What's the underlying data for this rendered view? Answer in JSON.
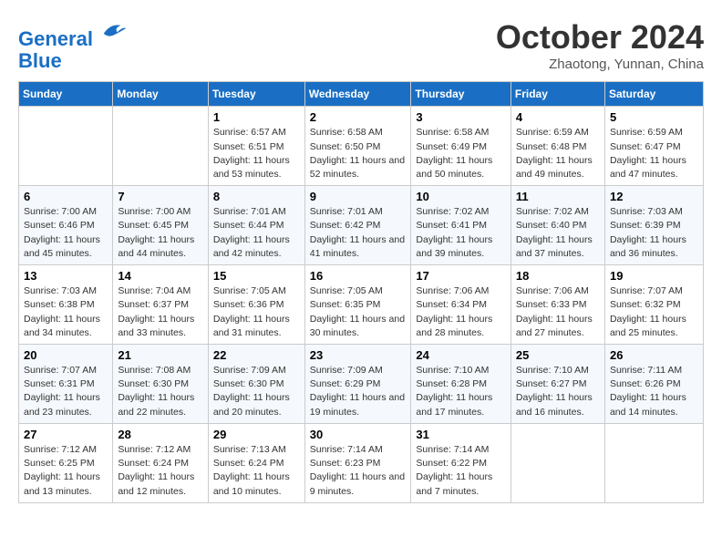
{
  "logo": {
    "line1": "General",
    "line2": "Blue"
  },
  "title": "October 2024",
  "subtitle": "Zhaotong, Yunnan, China",
  "days_of_week": [
    "Sunday",
    "Monday",
    "Tuesday",
    "Wednesday",
    "Thursday",
    "Friday",
    "Saturday"
  ],
  "weeks": [
    [
      {
        "day": "",
        "info": ""
      },
      {
        "day": "",
        "info": ""
      },
      {
        "day": "1",
        "sunrise": "6:57 AM",
        "sunset": "6:51 PM",
        "daylight": "11 hours and 53 minutes."
      },
      {
        "day": "2",
        "sunrise": "6:58 AM",
        "sunset": "6:50 PM",
        "daylight": "11 hours and 52 minutes."
      },
      {
        "day": "3",
        "sunrise": "6:58 AM",
        "sunset": "6:49 PM",
        "daylight": "11 hours and 50 minutes."
      },
      {
        "day": "4",
        "sunrise": "6:59 AM",
        "sunset": "6:48 PM",
        "daylight": "11 hours and 49 minutes."
      },
      {
        "day": "5",
        "sunrise": "6:59 AM",
        "sunset": "6:47 PM",
        "daylight": "11 hours and 47 minutes."
      }
    ],
    [
      {
        "day": "6",
        "sunrise": "7:00 AM",
        "sunset": "6:46 PM",
        "daylight": "11 hours and 45 minutes."
      },
      {
        "day": "7",
        "sunrise": "7:00 AM",
        "sunset": "6:45 PM",
        "daylight": "11 hours and 44 minutes."
      },
      {
        "day": "8",
        "sunrise": "7:01 AM",
        "sunset": "6:44 PM",
        "daylight": "11 hours and 42 minutes."
      },
      {
        "day": "9",
        "sunrise": "7:01 AM",
        "sunset": "6:42 PM",
        "daylight": "11 hours and 41 minutes."
      },
      {
        "day": "10",
        "sunrise": "7:02 AM",
        "sunset": "6:41 PM",
        "daylight": "11 hours and 39 minutes."
      },
      {
        "day": "11",
        "sunrise": "7:02 AM",
        "sunset": "6:40 PM",
        "daylight": "11 hours and 37 minutes."
      },
      {
        "day": "12",
        "sunrise": "7:03 AM",
        "sunset": "6:39 PM",
        "daylight": "11 hours and 36 minutes."
      }
    ],
    [
      {
        "day": "13",
        "sunrise": "7:03 AM",
        "sunset": "6:38 PM",
        "daylight": "11 hours and 34 minutes."
      },
      {
        "day": "14",
        "sunrise": "7:04 AM",
        "sunset": "6:37 PM",
        "daylight": "11 hours and 33 minutes."
      },
      {
        "day": "15",
        "sunrise": "7:05 AM",
        "sunset": "6:36 PM",
        "daylight": "11 hours and 31 minutes."
      },
      {
        "day": "16",
        "sunrise": "7:05 AM",
        "sunset": "6:35 PM",
        "daylight": "11 hours and 30 minutes."
      },
      {
        "day": "17",
        "sunrise": "7:06 AM",
        "sunset": "6:34 PM",
        "daylight": "11 hours and 28 minutes."
      },
      {
        "day": "18",
        "sunrise": "7:06 AM",
        "sunset": "6:33 PM",
        "daylight": "11 hours and 27 minutes."
      },
      {
        "day": "19",
        "sunrise": "7:07 AM",
        "sunset": "6:32 PM",
        "daylight": "11 hours and 25 minutes."
      }
    ],
    [
      {
        "day": "20",
        "sunrise": "7:07 AM",
        "sunset": "6:31 PM",
        "daylight": "11 hours and 23 minutes."
      },
      {
        "day": "21",
        "sunrise": "7:08 AM",
        "sunset": "6:30 PM",
        "daylight": "11 hours and 22 minutes."
      },
      {
        "day": "22",
        "sunrise": "7:09 AM",
        "sunset": "6:30 PM",
        "daylight": "11 hours and 20 minutes."
      },
      {
        "day": "23",
        "sunrise": "7:09 AM",
        "sunset": "6:29 PM",
        "daylight": "11 hours and 19 minutes."
      },
      {
        "day": "24",
        "sunrise": "7:10 AM",
        "sunset": "6:28 PM",
        "daylight": "11 hours and 17 minutes."
      },
      {
        "day": "25",
        "sunrise": "7:10 AM",
        "sunset": "6:27 PM",
        "daylight": "11 hours and 16 minutes."
      },
      {
        "day": "26",
        "sunrise": "7:11 AM",
        "sunset": "6:26 PM",
        "daylight": "11 hours and 14 minutes."
      }
    ],
    [
      {
        "day": "27",
        "sunrise": "7:12 AM",
        "sunset": "6:25 PM",
        "daylight": "11 hours and 13 minutes."
      },
      {
        "day": "28",
        "sunrise": "7:12 AM",
        "sunset": "6:24 PM",
        "daylight": "11 hours and 12 minutes."
      },
      {
        "day": "29",
        "sunrise": "7:13 AM",
        "sunset": "6:24 PM",
        "daylight": "11 hours and 10 minutes."
      },
      {
        "day": "30",
        "sunrise": "7:14 AM",
        "sunset": "6:23 PM",
        "daylight": "11 hours and 9 minutes."
      },
      {
        "day": "31",
        "sunrise": "7:14 AM",
        "sunset": "6:22 PM",
        "daylight": "11 hours and 7 minutes."
      },
      {
        "day": "",
        "info": ""
      },
      {
        "day": "",
        "info": ""
      }
    ]
  ],
  "labels": {
    "sunrise": "Sunrise:",
    "sunset": "Sunset:",
    "daylight": "Daylight:"
  }
}
